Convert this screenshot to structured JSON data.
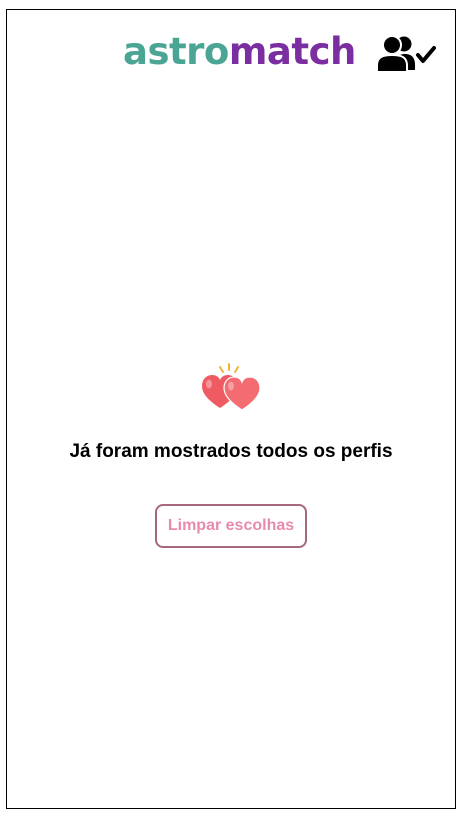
{
  "header": {
    "logo_part_a": "astro",
    "logo_part_b": "match",
    "matches_icon": "people-check-icon"
  },
  "empty_state": {
    "icon": "two-hearts-icon",
    "message": "Já foram mostrados todos os perfis",
    "clear_label": "Limpar escolhas"
  },
  "colors": {
    "logo_a": "#4aa594",
    "logo_b": "#7a2ea0",
    "heart": "#ef5b63",
    "button_text": "#e88aae",
    "button_border": "#a5687f"
  }
}
